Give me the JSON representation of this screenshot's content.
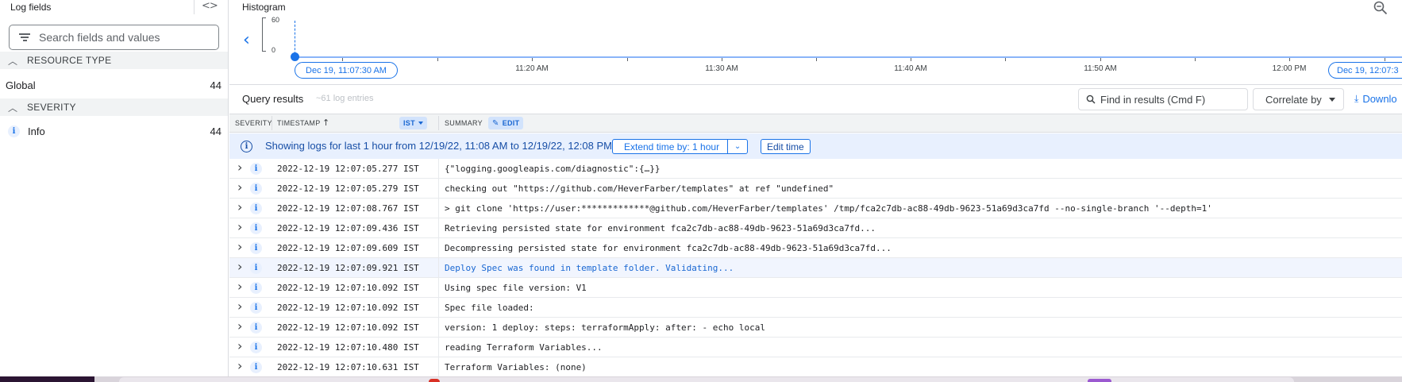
{
  "log_fields": {
    "title": "Log fields",
    "toggle_icon": "code-icon",
    "search_placeholder": "Search fields and values",
    "sections": [
      {
        "label": "RESOURCE TYPE",
        "items": [
          {
            "name": "Global",
            "count": "44"
          }
        ]
      },
      {
        "label": "SEVERITY",
        "items": [
          {
            "name": "Info",
            "count": "44",
            "icon": "i"
          }
        ]
      }
    ]
  },
  "histogram": {
    "title": "Histogram",
    "y_max": "60",
    "y_min": "0",
    "start_pill": "Dec 19, 11:07:30 AM",
    "end_pill": "Dec 19, 12:07:3",
    "time_labels": [
      "11:20 AM",
      "11:30 AM",
      "11:40 AM",
      "11:50 AM",
      "12:00 PM"
    ]
  },
  "query_results": {
    "title": "Query results",
    "count": "~61 log entries",
    "find_placeholder": "Find in results (Cmd F)",
    "correlate_label": "Correlate by",
    "download_label": "Downlo"
  },
  "columns": {
    "severity": "SEVERITY",
    "timestamp": "TIMESTAMP",
    "sort_icon": "↑",
    "timezone": "IST",
    "summary": "SUMMARY",
    "edit": "EDIT"
  },
  "banner": {
    "message": "Showing logs for last 1 hour from 12/19/22, 11:08 AM to 12/19/22, 12:08 PM.",
    "extend_label": "Extend time by: 1 hour",
    "edit_time_label": "Edit time"
  },
  "rows": [
    {
      "timestamp": "2022-12-19 12:07:05.277 IST",
      "summary": "{\"logging.googleapis.com/diagnostic\":{…}}"
    },
    {
      "timestamp": "2022-12-19 12:07:05.279 IST",
      "summary": "checking out \"https://github.com/HeverFarber/templates\" at ref \"undefined\""
    },
    {
      "timestamp": "2022-12-19 12:07:08.767 IST",
      "summary": "> git clone 'https://user:*************@github.com/HeverFarber/templates' /tmp/fca2c7db-ac88-49db-9623-51a69d3ca7fd --no-single-branch '--depth=1'"
    },
    {
      "timestamp": "2022-12-19 12:07:09.436 IST",
      "summary": "Retrieving persisted state for environment fca2c7db-ac88-49db-9623-51a69d3ca7fd..."
    },
    {
      "timestamp": "2022-12-19 12:07:09.609 IST",
      "summary": "Decompressing persisted state for environment fca2c7db-ac88-49db-9623-51a69d3ca7fd..."
    },
    {
      "timestamp": "2022-12-19 12:07:09.921 IST",
      "summary": "Deploy Spec was found in template folder. Validating...",
      "selected": true
    },
    {
      "timestamp": "2022-12-19 12:07:10.092 IST",
      "summary": "Using spec file version: V1"
    },
    {
      "timestamp": "2022-12-19 12:07:10.092 IST",
      "summary": "Spec file loaded:"
    },
    {
      "timestamp": "2022-12-19 12:07:10.092 IST",
      "summary": "version: 1 deploy: steps: terraformApply: after: - echo local"
    },
    {
      "timestamp": "2022-12-19 12:07:10.480 IST",
      "summary": "reading Terraform Variables..."
    },
    {
      "timestamp": "2022-12-19 12:07:10.631 IST",
      "summary": "Terraform Variables: (none)"
    }
  ]
}
